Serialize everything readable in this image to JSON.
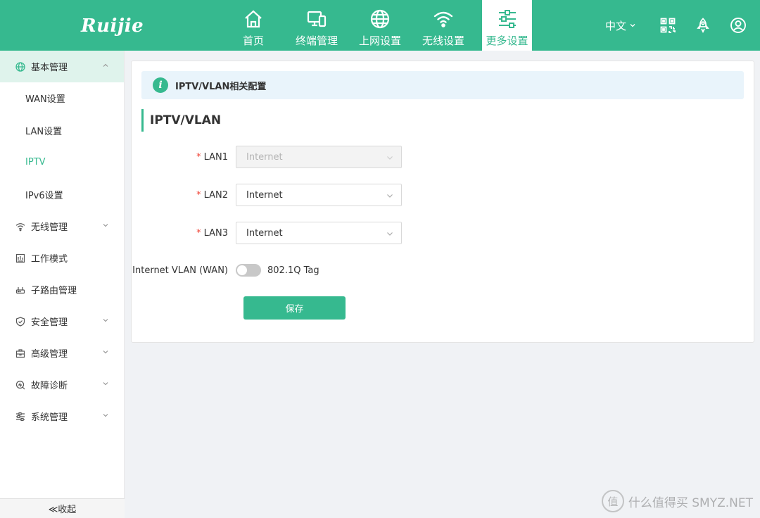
{
  "brand": {
    "logo_text": "Ruijie"
  },
  "nav": [
    {
      "label": "首页",
      "icon": "home-icon"
    },
    {
      "label": "终端管理",
      "icon": "devices-icon"
    },
    {
      "label": "上网设置",
      "icon": "globe-icon"
    },
    {
      "label": "无线设置",
      "icon": "wifi-icon"
    },
    {
      "label": "更多设置",
      "icon": "sliders-icon",
      "active": true
    }
  ],
  "header_right": {
    "language": "中文",
    "icons": [
      "qrcode-icon",
      "rocket-icon",
      "user-icon"
    ]
  },
  "sidebar": {
    "groups": [
      {
        "label": "基本管理",
        "icon": "globe-icon",
        "open": true,
        "items": [
          "WAN设置",
          "LAN设置",
          "IPTV",
          "IPv6设置"
        ],
        "active_item": "IPTV"
      },
      {
        "label": "无线管理",
        "icon": "wifi-icon"
      },
      {
        "label": "工作模式",
        "icon": "mode-icon"
      },
      {
        "label": "子路由管理",
        "icon": "router-icon"
      },
      {
        "label": "安全管理",
        "icon": "shield-icon"
      },
      {
        "label": "高级管理",
        "icon": "toolbox-icon"
      },
      {
        "label": "故障诊断",
        "icon": "diagnose-icon"
      },
      {
        "label": "系统管理",
        "icon": "settings-icon"
      }
    ],
    "collapse_label": "≪收起"
  },
  "main": {
    "info_text": "IPTV/VLAN相关配置",
    "section_title": "IPTV/VLAN",
    "fields": [
      {
        "label": "LAN1",
        "value": "Internet",
        "required": true,
        "disabled": true
      },
      {
        "label": "LAN2",
        "value": "Internet",
        "required": true,
        "disabled": false
      },
      {
        "label": "LAN3",
        "value": "Internet",
        "required": true,
        "disabled": false
      }
    ],
    "vlan_label": "Internet VLAN (WAN)",
    "vlan_toggle_text": "802.1Q Tag",
    "vlan_toggle_on": false,
    "save_label": "保存"
  },
  "watermark": {
    "badge": "值",
    "text": "什么值得买 SMYZ.NET"
  },
  "colors": {
    "accent": "#36b98f",
    "info_bg": "#e9f4fb",
    "required": "#f04134"
  }
}
